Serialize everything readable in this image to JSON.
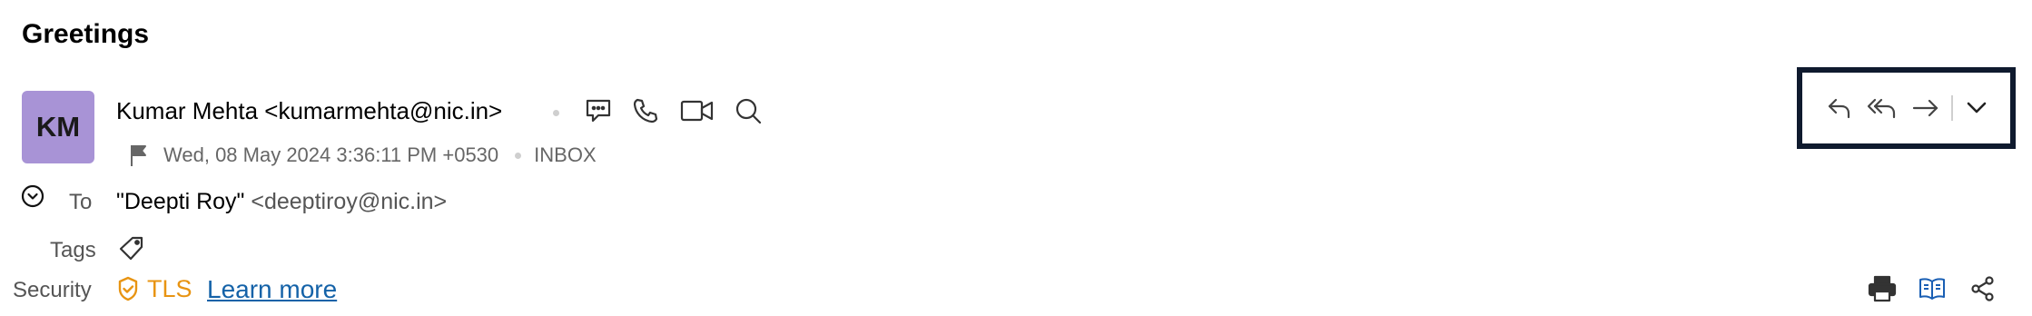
{
  "email": {
    "subject": "Greetings",
    "avatar_initials": "KM",
    "sender": "Kumar Mehta <kumarmehta@nic.in>",
    "date": "Wed, 08 May 2024 3:36:11 PM +0530",
    "folder": "INBOX",
    "to_label": "To",
    "to_name": "\"Deepti Roy\"",
    "to_email": "<deeptiroy@nic.in>",
    "tags_label": "Tags",
    "security_label": "Security",
    "security_value": "TLS",
    "learn_more": "Learn more"
  },
  "colors": {
    "avatar_bg": "#a893d6",
    "tls_orange": "#e89412",
    "link_blue": "#1462a8",
    "focus_border": "#0f1a2e"
  },
  "icons": {
    "sender_actions": [
      "chat-icon",
      "phone-icon",
      "video-icon",
      "search-icon"
    ],
    "reply_actions": [
      "reply-icon",
      "reply-all-icon",
      "forward-icon",
      "chevron-down-icon"
    ],
    "bottom_actions": [
      "print-icon",
      "reader-view-icon",
      "share-icon"
    ]
  }
}
